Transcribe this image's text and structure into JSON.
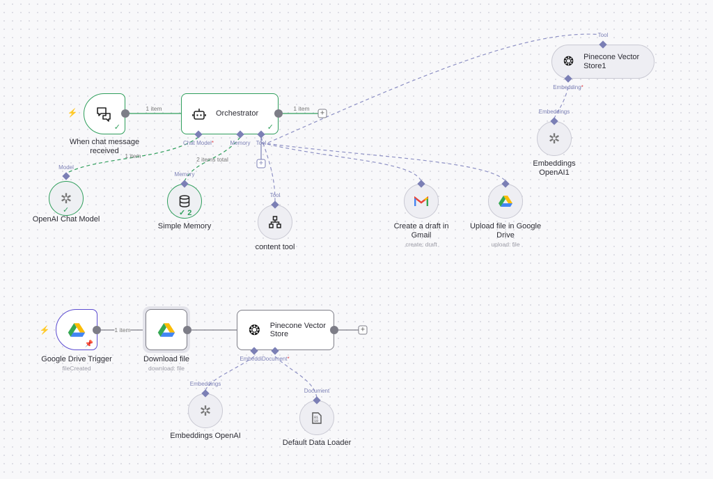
{
  "nodes": {
    "chat_trigger": {
      "label": "When chat message received",
      "status": "success"
    },
    "orchestrator": {
      "label": "Orchestrator",
      "ports": {
        "chat_model": "Chat Model",
        "memory": "Memory",
        "tool": "Tool"
      },
      "status": "success"
    },
    "openai_chat": {
      "label": "OpenAI Chat Model",
      "port": "Model",
      "status": "success"
    },
    "simple_memory": {
      "label": "Simple Memory",
      "port": "Memory",
      "run_count": "2"
    },
    "content_tool": {
      "label": "content tool",
      "port": "Tool"
    },
    "gmail": {
      "label_1": "Create a draft in",
      "label_2": "Gmail",
      "sub": "create: draft"
    },
    "drive_upload": {
      "label_1": "Upload file in Google",
      "label_2": "Drive",
      "sub": "upload: file"
    },
    "pinecone1": {
      "label_1": "Pinecone Vector",
      "label_2": "Store1",
      "port_top": "Tool",
      "port_bottom": "Embedding"
    },
    "embeddings1": {
      "label_1": "Embeddings",
      "label_2": "OpenAI1",
      "port": "Embeddings"
    },
    "drive_trigger": {
      "label": "Google Drive Trigger",
      "sub": "fileCreated"
    },
    "download": {
      "label": "Download file",
      "sub": "download: file"
    },
    "pinecone": {
      "label_1": "Pinecone Vector",
      "label_2": "Store",
      "port_embedding": "Embeddi",
      "port_document": "Document"
    },
    "embeddings": {
      "label": "Embeddings OpenAI",
      "port": "Embeddings"
    },
    "loader": {
      "label": "Default Data Loader",
      "port": "Document"
    }
  },
  "edges": {
    "chat_to_orch": "1 item",
    "orch_out": "1 item",
    "model": "1 item",
    "memory": "2 items total",
    "trigger_to_download": "1 item"
  },
  "required_mark": "*",
  "plus": "+",
  "colors": {
    "success": "#2e9e5b",
    "ai_port": "#7b7fb5",
    "trigger": "#f0604b",
    "pinned": "#5b4bd0"
  }
}
